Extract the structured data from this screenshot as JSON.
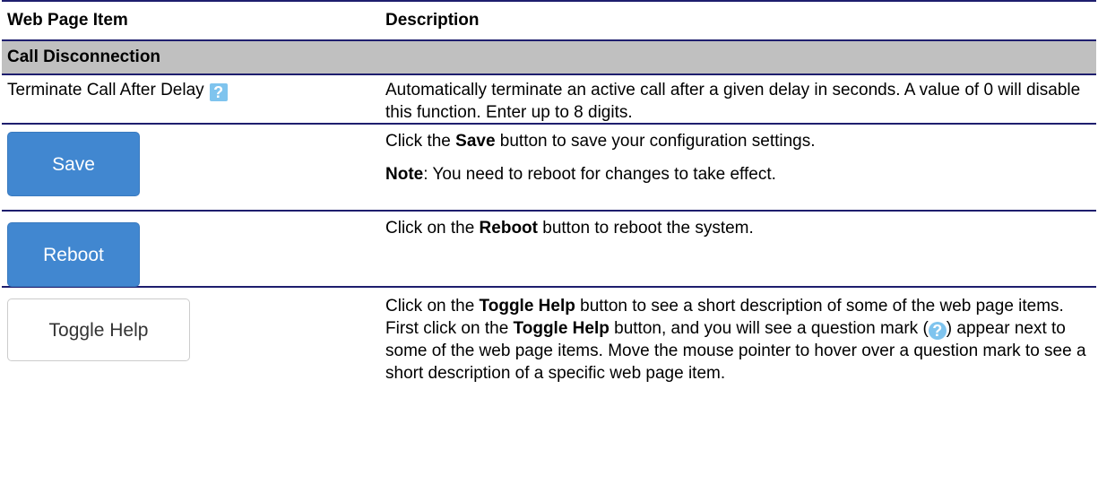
{
  "header": {
    "col_item": "Web Page Item",
    "col_description": "Description"
  },
  "section": {
    "title": "Call Disconnection"
  },
  "rows": {
    "terminate": {
      "item_label": "Terminate Call After Delay",
      "help_icon": "?",
      "description": "Automatically terminate an active call after a given delay in seconds. A value of 0 will disable this function. Enter up to 8 digits."
    },
    "save": {
      "button_label": "Save",
      "desc_pre": "Click the ",
      "desc_bold": "Save",
      "desc_post": " button to save your configuration settings.",
      "note_bold": "Note",
      "note_text": ": You need to reboot for changes to take effect."
    },
    "reboot": {
      "button_label": "Reboot",
      "desc_pre": "Click on the ",
      "desc_bold": "Reboot",
      "desc_post": " button to reboot the system."
    },
    "toggle": {
      "button_label": "Toggle Help",
      "desc_1": "Click on the ",
      "desc_bold_1": "Toggle Help",
      "desc_2": " button to see a short description of some of the web page items. First click on the ",
      "desc_bold_2": "Toggle Help",
      "desc_3": " button, and you will see a question mark (",
      "help_icon": "?",
      "desc_4": ") appear next to some of the web page items. Move the mouse pointer to hover over a question mark to see a short description of a specific web page item."
    }
  },
  "colors": {
    "rule": "#1e1e6e",
    "section_bg": "#c0c0c0",
    "button_blue": "#4187d0",
    "help_icon_bg": "#7fc4ee"
  }
}
